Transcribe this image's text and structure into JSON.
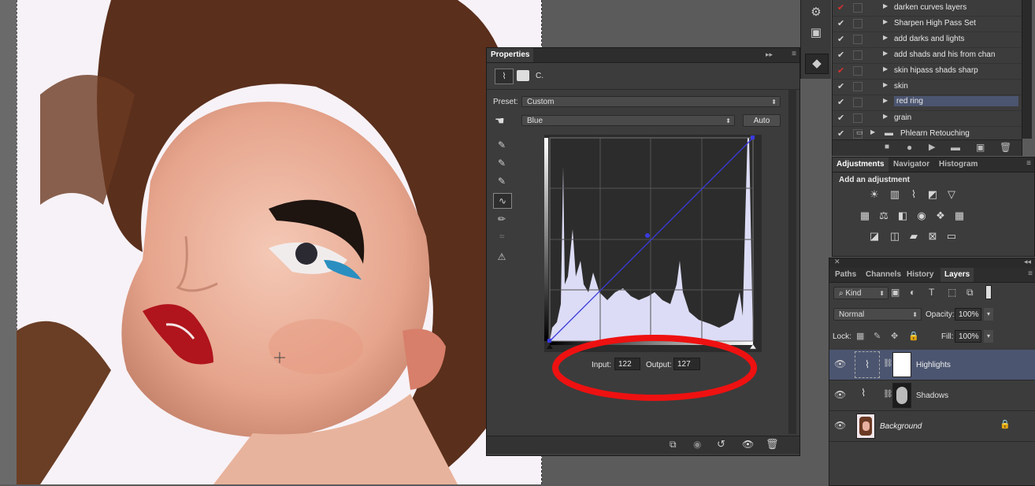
{
  "canvas": {
    "photo_alt": "portrait of woman with red lips and blue eyeliner"
  },
  "properties": {
    "tab": "Properties",
    "layer_label": "C.",
    "preset_label": "Preset:",
    "preset_value": "Custom",
    "channel_value": "Blue",
    "auto_label": "Auto",
    "input_label": "Input:",
    "input_value": "122",
    "output_label": "Output:",
    "output_value": "127"
  },
  "actions": {
    "rows": [
      {
        "label": "darken curves layers",
        "check": "red"
      },
      {
        "label": "Sharpen High Pass Set",
        "check": "white"
      },
      {
        "label": "add darks and lights",
        "check": "white"
      },
      {
        "label": "add shads and his from chan",
        "check": "white"
      },
      {
        "label": "skin hipass shads sharp",
        "check": "red"
      },
      {
        "label": "skin",
        "check": "white"
      },
      {
        "label": "red ring",
        "check": "white"
      },
      {
        "label": "grain",
        "check": "white"
      },
      {
        "label": "Phlearn Retouching",
        "check": "white"
      }
    ]
  },
  "adjustments": {
    "tabs": [
      "Adjustments",
      "Navigator",
      "Histogram"
    ],
    "heading": "Add an adjustment"
  },
  "layers_panel": {
    "tabs": [
      "Paths",
      "Channels",
      "History",
      "Layers"
    ],
    "kind_label": "Kind",
    "blend_mode": "Normal",
    "opacity_label": "Opacity:",
    "opacity_value": "100%",
    "lock_label": "Lock:",
    "fill_label": "Fill:",
    "fill_value": "100%",
    "layers": [
      {
        "name": "Highlights"
      },
      {
        "name": "Shadows"
      },
      {
        "name": "Background"
      }
    ]
  },
  "colors": {
    "annotation": "#ee1111",
    "curve": "#3a3ae0",
    "histogram": "#dcdcf6",
    "selected_layer": "#4b5570"
  }
}
